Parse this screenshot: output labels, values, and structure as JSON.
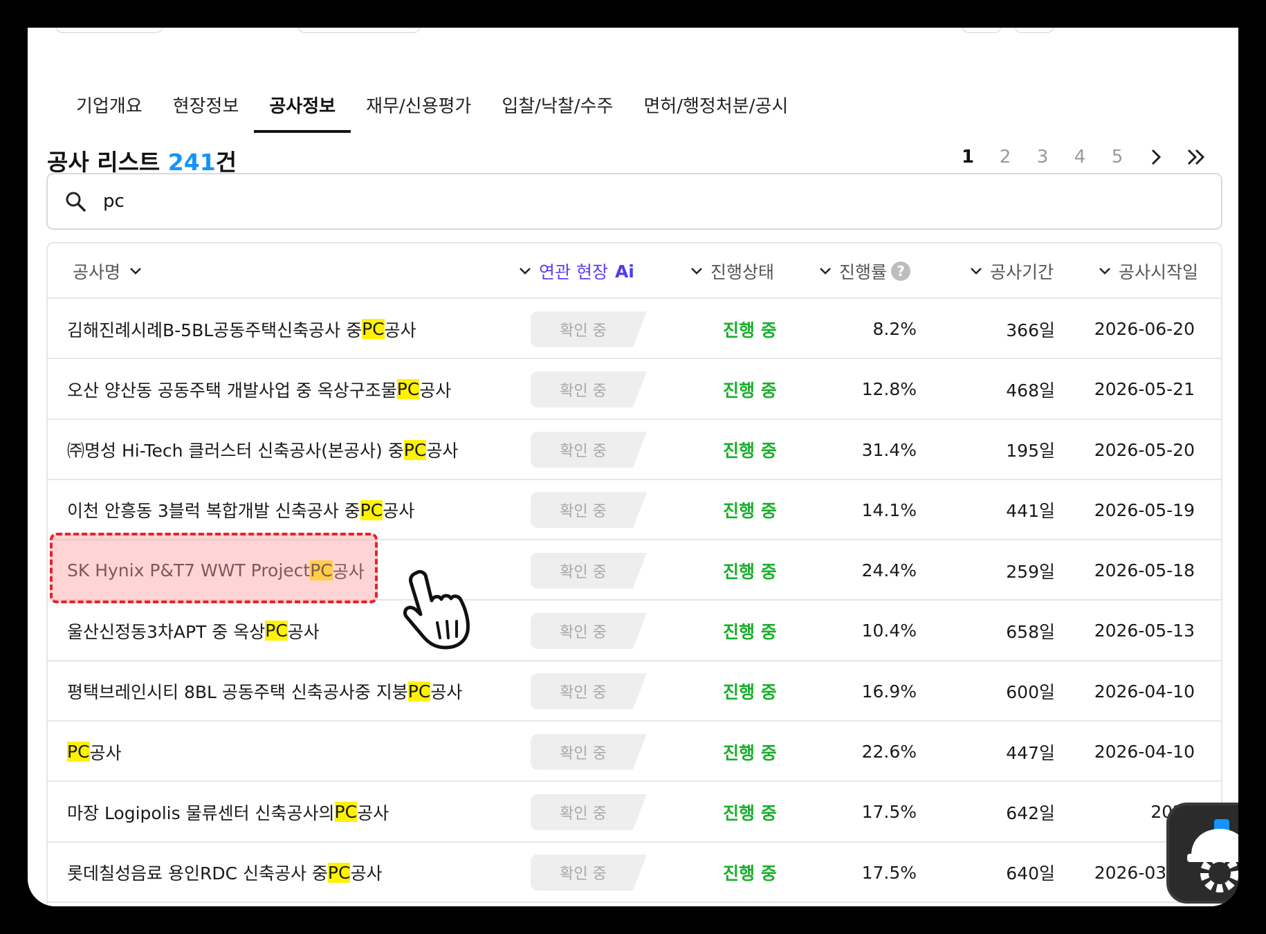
{
  "tabs": [
    {
      "label": "기업개요"
    },
    {
      "label": "현장정보"
    },
    {
      "label": "공사정보"
    },
    {
      "label": "재무/신용평가"
    },
    {
      "label": "입찰/낙찰/수주"
    },
    {
      "label": "면허/행정처분/공시"
    }
  ],
  "active_tab": "공사정보",
  "list": {
    "title": "공사 리스트",
    "count": "241",
    "count_suffix": "건"
  },
  "pagination": {
    "pages": [
      "1",
      "2",
      "3",
      "4",
      "5"
    ],
    "current": "1"
  },
  "search": {
    "value": "pc"
  },
  "table": {
    "headers": {
      "name": "공사명",
      "site": "연관 현장",
      "site_ai": "Ai",
      "status": "진행상태",
      "rate": "진행률",
      "rate_help": "?",
      "period": "공사기간",
      "start": "공사시작일"
    },
    "rows": [
      {
        "name_pre": "김해진례시례B-5BL공동주택신축공사 중 ",
        "name_hl": "PC",
        "name_post": "공사",
        "badge": "확인 중",
        "status": "진행 중",
        "rate": "8.2%",
        "period": "366일",
        "start": "2026-06-20"
      },
      {
        "name_pre": "오산 양산동 공동주택 개발사업 중 옥상구조물 ",
        "name_hl": "PC",
        "name_post": "공사",
        "badge": "확인 중",
        "status": "진행 중",
        "rate": "12.8%",
        "period": "468일",
        "start": "2026-05-21"
      },
      {
        "name_pre": "㈜명성 Hi-Tech 클러스터 신축공사(본공사) 중 ",
        "name_hl": "PC",
        "name_post": "공사",
        "badge": "확인 중",
        "status": "진행 중",
        "rate": "31.4%",
        "period": "195일",
        "start": "2026-05-20"
      },
      {
        "name_pre": "이천 안흥동 3블럭 복합개발 신축공사 중 ",
        "name_hl": "PC",
        "name_post": "공사",
        "badge": "확인 중",
        "status": "진행 중",
        "rate": "14.1%",
        "period": "441일",
        "start": "2026-05-19"
      },
      {
        "name_pre": "SK Hynix P&T7 WWT Project ",
        "name_hl": "PC",
        "name_post": "공사",
        "badge": "확인 중",
        "status": "진행 중",
        "rate": "24.4%",
        "period": "259일",
        "start": "2026-05-18"
      },
      {
        "name_pre": "울산신정동3차APT 중 옥상",
        "name_hl": "PC",
        "name_post": "공사",
        "badge": "확인 중",
        "status": "진행 중",
        "rate": "10.4%",
        "period": "658일",
        "start": "2026-05-13"
      },
      {
        "name_pre": "평택브레인시티 8BL 공동주택 신축공사중 지붕",
        "name_hl": "PC",
        "name_post": "공사",
        "badge": "확인 중",
        "status": "진행 중",
        "rate": "16.9%",
        "period": "600일",
        "start": "2026-04-10"
      },
      {
        "name_pre": "",
        "name_hl": "PC",
        "name_post": "공사",
        "badge": "확인 중",
        "status": "진행 중",
        "rate": "22.6%",
        "period": "447일",
        "start": "2026-04-10"
      },
      {
        "name_pre": "마장 Logipolis 물류센터 신축공사의 ",
        "name_hl": "PC",
        "name_post": "공사",
        "badge": "확인 중",
        "status": "진행 중",
        "rate": "17.5%",
        "period": "642일",
        "start": "2026"
      },
      {
        "name_pre": "롯데칠성음료 용인RDC 신축공사 중 ",
        "name_hl": "PC",
        "name_post": "공사",
        "badge": "확인 중",
        "status": "진행 중",
        "rate": "17.5%",
        "period": "640일",
        "start": "2026-03-30"
      }
    ]
  },
  "colors": {
    "accent_blue": "#1493ff",
    "ai_purple": "#5b3ef5",
    "status_green": "#17b02a",
    "highlight_yellow": "#fff200",
    "annotation_red": "#e8202a"
  }
}
